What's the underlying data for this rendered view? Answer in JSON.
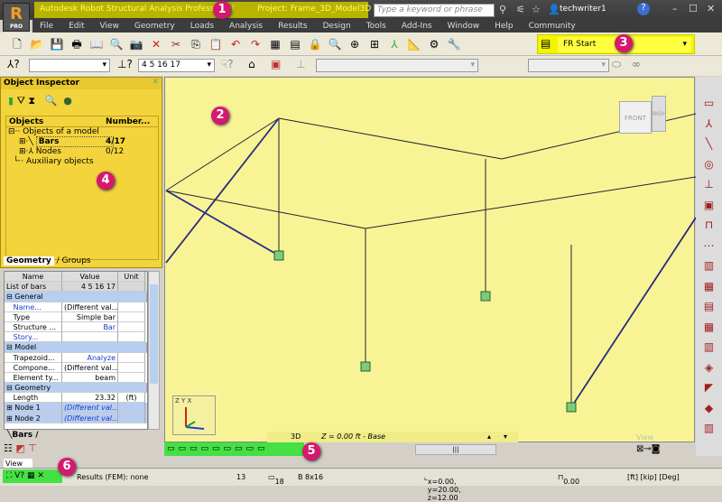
{
  "app": {
    "logo": "R",
    "edition": "PRO",
    "title": "Autodesk Robot Structural Analysis Professional",
    "project": "Project: Frame_3D_Model3D - R...",
    "search_placeholder": "Type a keyword or phrase",
    "user": "techwriter1"
  },
  "menu": [
    "File",
    "Edit",
    "View",
    "Geometry",
    "Loads",
    "Analysis",
    "Results",
    "Design",
    "Tools",
    "Add-Ins",
    "Window",
    "Help",
    "Community"
  ],
  "toolbar": {
    "case_selector": "Start",
    "bar_selection": "4 5 16 17"
  },
  "callouts": [
    "1",
    "2",
    "3",
    "4",
    "5",
    "6"
  ],
  "inspector": {
    "title": "Object Inspector",
    "col_objects": "Objects",
    "col_number": "Number...",
    "root": "Objects of a model",
    "items": [
      {
        "label": "Bars",
        "count": "4/17"
      },
      {
        "label": "Nodes",
        "count": "0/12"
      }
    ],
    "auxiliary": "Auxiliary objects",
    "tabs": [
      "Geometry",
      "Groups"
    ]
  },
  "props": {
    "headers": [
      "Name",
      "Value",
      "Unit"
    ],
    "rows": [
      {
        "type": "row",
        "name": "List of bars",
        "value": "4 5 16 17",
        "unit": ""
      },
      {
        "type": "group",
        "name": "General"
      },
      {
        "type": "row",
        "name": "Name...",
        "value": "(Different val...",
        "unit": "",
        "blue_name": true
      },
      {
        "type": "row",
        "name": "Type",
        "value": "Simple bar",
        "unit": ""
      },
      {
        "type": "row",
        "name": "Structure ...",
        "value": "Bar",
        "unit": "",
        "blue_value": true
      },
      {
        "type": "row",
        "name": "Story...",
        "value": "",
        "unit": "",
        "blue_name": true
      },
      {
        "type": "group",
        "name": "Model"
      },
      {
        "type": "row",
        "name": "Trapezoid...",
        "value": "Analyze",
        "unit": "",
        "blue_value": true
      },
      {
        "type": "row",
        "name": "Compone...",
        "value": "(Different val...",
        "unit": ""
      },
      {
        "type": "row",
        "name": "Element ty...",
        "value": "beam",
        "unit": ""
      },
      {
        "type": "group",
        "name": "Geometry"
      },
      {
        "type": "row",
        "name": "Length",
        "value": "23.32",
        "unit": "(ft)"
      },
      {
        "type": "sel",
        "name": "Node 1",
        "value": "(Different val...",
        "unit": ""
      },
      {
        "type": "sel",
        "name": "Node 2",
        "value": "(Different val...",
        "unit": ""
      }
    ],
    "tab": "Bars"
  },
  "viewport": {
    "cube_front": "FRONT",
    "cube_right": "RIGHT",
    "mode": "3D",
    "level": "Z = 0.00 ft - Base",
    "view": "View",
    "axes": "Z Y X"
  },
  "bottom": {
    "view_label": "View",
    "results": "Results (FEM): none"
  },
  "status": {
    "nodes": "13",
    "bars": "18",
    "section": "B 8x16",
    "coords": "x=0.00, y=20.00, z=12.00",
    "angle": "0.00",
    "units": "[ft] [kip] [Deg]"
  },
  "colors": {
    "highlight_yellow": "#f4f400",
    "highlight_green": "#44e044",
    "callout": "#d6186e",
    "viewport": "#f8f495"
  }
}
